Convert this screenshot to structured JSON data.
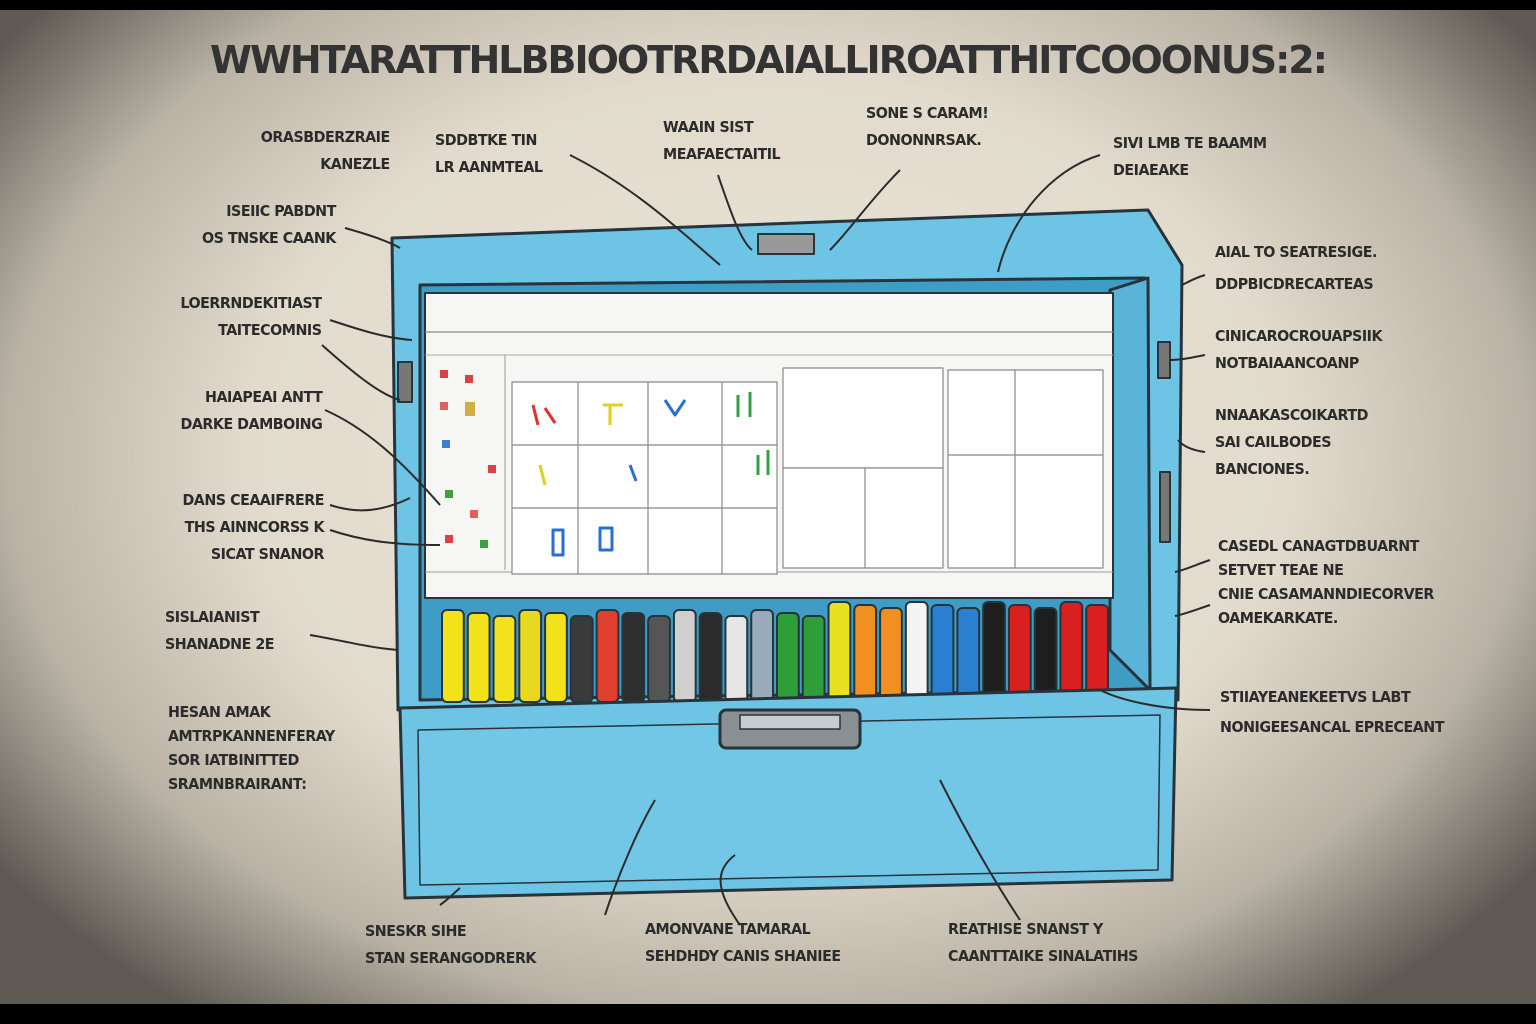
{
  "title": "WWHTARATTHLBBIOOTRRDAIALLIROATTHITCOOONUS:2:",
  "labels": {
    "top1": [
      "ORASBDERZRAIE",
      "KANEZLE"
    ],
    "top2": [
      "SDDBTKE TIN",
      "LR AANMTEAL"
    ],
    "top3": [
      "WAAIN SIST",
      "MEAFAECTAITIL"
    ],
    "top4": [
      "SONE S CARAM!",
      "DONONNRSAK."
    ],
    "top5": [
      "SIVI LMB TE BAAMM",
      "DEIAEAKE"
    ],
    "left1": [
      "ISEIIC PABDNT",
      "OS TNSKE CAANK"
    ],
    "left2": [
      "LOERRNDEKITIAST",
      "TAITECOMNIS"
    ],
    "left3": [
      "HAIAPEAI ANTT",
      "DARKE DAMBOING"
    ],
    "left4": [
      "DANS CEAAIFRERE",
      "THS AINNCORSS K",
      "SICAT SNANOR"
    ],
    "left5": [
      "SISLAIANIST",
      "SHANADNE 2E"
    ],
    "left6": [
      "HESAN AMAK",
      "AMTRPKANNENFERAY",
      "SOR IATBINITTED",
      "SRAMNBRAIRANT:"
    ],
    "right1": [
      "AIAL TO SEATRESIGE.",
      "DDPBICDRECARTEAS"
    ],
    "right2": [
      "CINICAROCROUAPSIIK",
      "NOTBAIAANCOANP"
    ],
    "right3": [
      "NNAAKASCOIKARTD",
      "SAI CAILBODES",
      "BANCIONES."
    ],
    "right4": [
      "CASEDL CANAGTDBUARNT",
      "SETVET TEAE NE",
      "CNIE CASAMANNDIECORVER",
      "OAMEKARKATE."
    ],
    "right5": [
      "STIIAYEANEKEETVS LABT",
      "NONIGEESANCAL EPRECEANT"
    ],
    "bottom1": [
      "SNESKR SIHE",
      "STAN SERANGODRERK"
    ],
    "bottom2": [
      "AMONVANE TAMARAL",
      "SEHDHDY CANIS SHANIEE"
    ],
    "bottom3": [
      "REATHISE SNANST Y",
      "CAANTTAIKE SINALATIHS"
    ]
  },
  "colors": {
    "box": "#6ec4e4",
    "box_dark": "#4aa6cc",
    "outline": "#27343c"
  },
  "markers": [
    "#f2e21c",
    "#f2e21c",
    "#f2e21c",
    "#e8d820",
    "#f2e21c",
    "#3a3a3a",
    "#e04030",
    "#2e2e2e",
    "#555",
    "#cfcfcf",
    "#2b2b2b",
    "#e6e6e6",
    "#9ab",
    "#2f9e3a",
    "#2f9e3a",
    "#e8e020",
    "#f09020",
    "#f09020",
    "#f4f4f4",
    "#2a7fd0",
    "#2a7fd0",
    "#1e1e1e",
    "#d82020",
    "#1e1e1e",
    "#d82020",
    "#d82020"
  ]
}
